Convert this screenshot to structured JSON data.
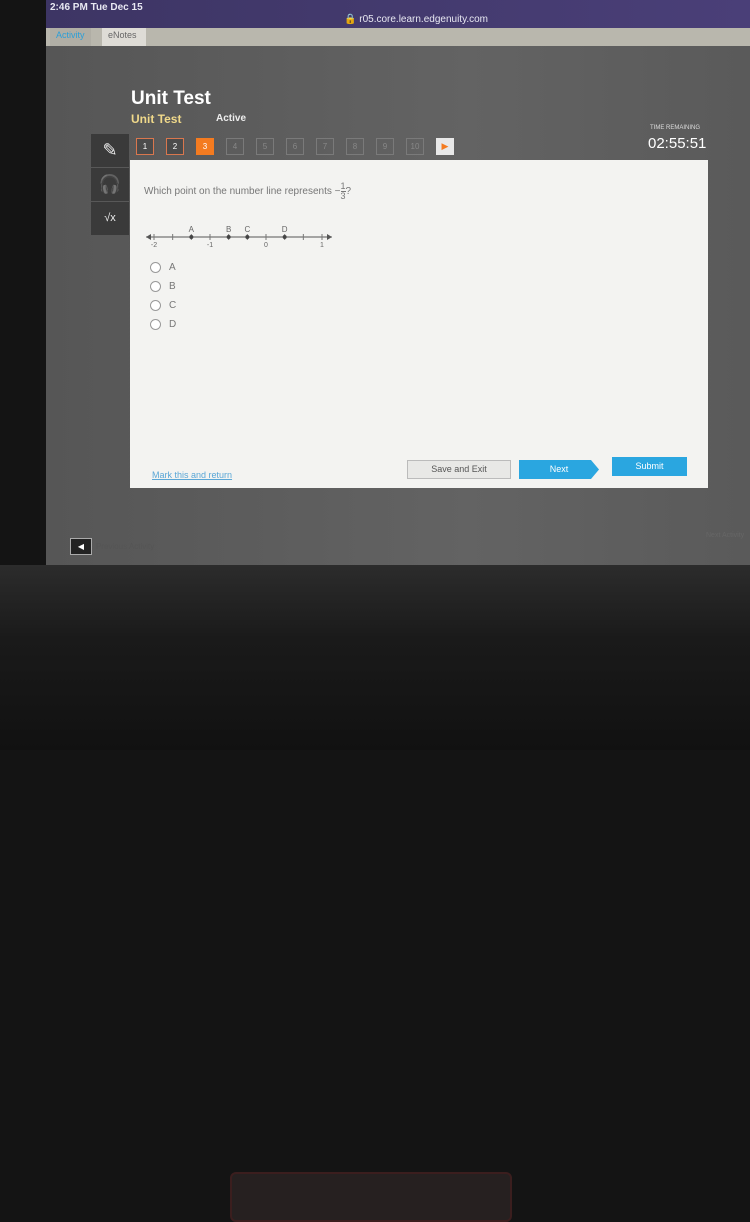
{
  "status": {
    "time": "2:46 PM  Tue Dec 15",
    "url": "r05.core.learn.edgenuity.com"
  },
  "tabs": [
    {
      "label": "Activity"
    },
    {
      "label": "eNotes"
    }
  ],
  "header": {
    "title": "Unit Test",
    "subtitle": "Unit Test",
    "state": "Active",
    "timer_label": "TIME REMAINING",
    "timer": "02:55:51"
  },
  "questions": [
    {
      "n": "1",
      "state": "answered"
    },
    {
      "n": "2",
      "state": "answered"
    },
    {
      "n": "3",
      "state": "current"
    },
    {
      "n": "4"
    },
    {
      "n": "5"
    },
    {
      "n": "6"
    },
    {
      "n": "7"
    },
    {
      "n": "8"
    },
    {
      "n": "9"
    },
    {
      "n": "10"
    }
  ],
  "tools": [
    "pencil-icon",
    "headphones-icon",
    "calculator-icon"
  ],
  "question": {
    "prompt": "Which point on the number line represents ",
    "fraction_sign": "−",
    "fraction_num": "1",
    "fraction_den": "3",
    "suffix": "?"
  },
  "number_line": {
    "ticks": [
      "-2",
      "-1",
      "0",
      "1"
    ],
    "points": [
      {
        "label": "A",
        "value": -1.333
      },
      {
        "label": "B",
        "value": -0.667
      },
      {
        "label": "C",
        "value": -0.333
      },
      {
        "label": "D",
        "value": 0.333
      }
    ]
  },
  "options": [
    {
      "label": "A"
    },
    {
      "label": "B"
    },
    {
      "label": "C"
    },
    {
      "label": "D"
    }
  ],
  "footer": {
    "mark": "Mark this and return",
    "save": "Save and Exit",
    "next": "Next",
    "submit": "Submit"
  },
  "bottom": {
    "prev_label": "Previous Activity",
    "next_label": "Next Activity"
  }
}
